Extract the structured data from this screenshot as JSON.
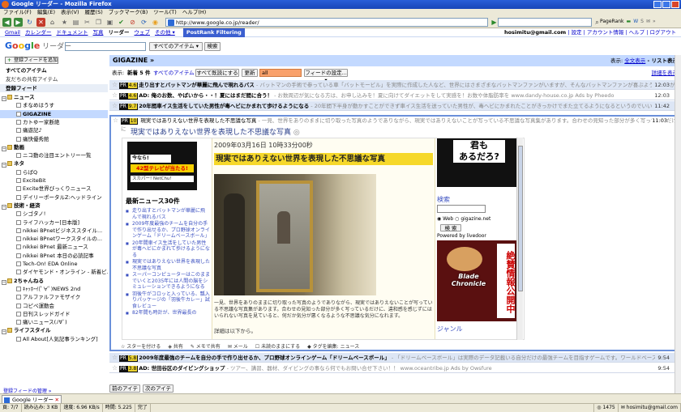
{
  "window": {
    "title": "Google リーダー - Mozilla Firefox"
  },
  "menu": [
    "ファイル(F)",
    "編集(E)",
    "表示(V)",
    "履歴(S)",
    "ブックマーク(B)",
    "ツール(T)",
    "ヘルプ(H)"
  ],
  "nav": {
    "url": "http://www.google.co.jp/reader/",
    "pagerank": "PageRank"
  },
  "gbar": {
    "links": [
      "Gmail",
      "カレンダー",
      "ドキュメント",
      "写真"
    ],
    "current": "リーダー",
    "links2": [
      "ウェブ",
      "その他 ▾"
    ],
    "prf": "PostRank Filtering",
    "email": "hosimitu@gmail.com",
    "right_links": "設定 | アカウント情報 | ヘルプ | ログアウト"
  },
  "header": {
    "logo_google": [
      "G",
      "o",
      "o",
      "g",
      "l",
      "e"
    ],
    "logo_reader": " リーダー",
    "all_items_btn": "すべてのアイテム ▾",
    "search_btn": "検索"
  },
  "sidebar": {
    "add_feed": "登録フィードを追加",
    "top": [
      {
        "label": "すべてのアイテム",
        "bold": true
      },
      {
        "label": "友だちの共有アイテム",
        "bold": false
      }
    ],
    "section": "登録フィード",
    "items": [
      {
        "label": "ニュース",
        "type": "folder",
        "indent": 0,
        "toggle": "−"
      },
      {
        "label": "まなめはうす",
        "type": "feed",
        "indent": 1
      },
      {
        "label": "GIGAZINE",
        "type": "feed",
        "indent": 1,
        "selected": true
      },
      {
        "label": "カトゆー家断絶",
        "type": "feed",
        "indent": 1
      },
      {
        "label": "痛遊記♪",
        "type": "feed",
        "indent": 1
      },
      {
        "label": "痛快優秀館",
        "type": "feed",
        "indent": 1
      },
      {
        "label": "動画",
        "type": "folder",
        "indent": 0,
        "toggle": "−"
      },
      {
        "label": "ニコ動の注目エントリー一覧",
        "type": "feed",
        "indent": 1
      },
      {
        "label": "ネタ",
        "type": "folder",
        "indent": 0,
        "toggle": "−"
      },
      {
        "label": "らばQ",
        "type": "feed",
        "indent": 1
      },
      {
        "label": "ExciteBit",
        "type": "feed",
        "indent": 1
      },
      {
        "label": "Excite世界びっくりニュース",
        "type": "feed",
        "indent": 1
      },
      {
        "label": "デイリーポータルZ:ヘッドライン",
        "type": "feed",
        "indent": 1
      },
      {
        "label": "技術・経済",
        "type": "folder",
        "indent": 0,
        "toggle": "−"
      },
      {
        "label": "シゴタノ!",
        "type": "feed",
        "indent": 1
      },
      {
        "label": "ライフハッカー[日本版]",
        "type": "feed",
        "indent": 1
      },
      {
        "label": "nikkei BPnetビジネススタイル...",
        "type": "feed",
        "indent": 1
      },
      {
        "label": "nikkei BPnetワークスタイルの...",
        "type": "feed",
        "indent": 1
      },
      {
        "label": "nikkei BPnet 最新ニュース",
        "type": "feed",
        "indent": 1
      },
      {
        "label": "nikkei BPnet 本日の必読記事",
        "type": "feed",
        "indent": 1
      },
      {
        "label": "Tech-On! EDA Online",
        "type": "feed",
        "indent": 1
      },
      {
        "label": "ダイヤモンド・オンライン - 新着ビ...",
        "type": "feed",
        "indent": 1
      },
      {
        "label": "2ちゃんねる",
        "type": "folder",
        "indent": 0,
        "toggle": "−"
      },
      {
        "label": "ｷｬｯﾎｰｲ(ﾟ∀ﾟ)NEWS 2nd",
        "type": "feed",
        "indent": 1
      },
      {
        "label": "アルファルファモザイク",
        "type": "feed",
        "indent": 1
      },
      {
        "label": "コピペ運動会",
        "type": "feed",
        "indent": 1
      },
      {
        "label": "日刊スレッドガイド",
        "type": "feed",
        "indent": 1
      },
      {
        "label": "痛いニュース(ﾉ∀`)",
        "type": "feed",
        "indent": 1
      },
      {
        "label": "ライフスタイル",
        "type": "folder",
        "indent": 0,
        "toggle": "−"
      },
      {
        "label": "All About[人気記事ランキング]",
        "type": "feed",
        "indent": 1
      }
    ],
    "footer": "登録フィードの管理 »"
  },
  "main": {
    "feed_title": "GIGAZINE »",
    "view_label": "表示: ",
    "view_full": "全文表示",
    "view_list": " - リスト表示",
    "toolbar": {
      "show_label": "表示:",
      "new_count": "新着 5 件",
      "all_items": "すべてのアイテム",
      "mark_all": "すべて既読にする",
      "refresh": "更新",
      "filter_value": "all",
      "feed_settings": "フィードの設定... ▾",
      "detail": "詳細を表示"
    },
    "entries": [
      {
        "score": "4.6",
        "title": "走り出すとバットマンが華麗に飛んで現れるバス",
        "snippet": " - バットマンの手術で参っている車「バットモービル」を実際に作成した人など、世界にはさまざまなバットマンファンがいますが、そんなバットマンファンが喜ぶようなバスがイ",
        "time": "12:03",
        "bold": true,
        "shade": true
      },
      {
        "score": "4.6",
        "title": "AD: 俺のお数、やばいから・・！夏にはまだ間に合う！",
        "snippet": " - お数周辺が気になる方は、お申し込みを！夏に向けてダイエットをして実感を！お数や体脂肪率を www.dandy-house.co.jp Ads by Pheedo",
        "time": "12:03",
        "bold": true,
        "shade": false
      },
      {
        "score": "9.7",
        "title": "20年間車イス生活をしていた男性が毒ヘビにかまれて歩けるようになる",
        "snippet": " - 20年間下半身が動かすことができず車イス生活を送っていた男性が、毒ヘビにかまれたことがきっかけでまた立てるようになるというのでいいです。",
        "time": "11:42",
        "bold": true,
        "shade": true
      }
    ],
    "open": {
      "score": "10",
      "title": "現実ではありえない世界を表現した不思議な写真",
      "snippet": " - 一見、世界をありのままに切り取った写真のようでありながら、現実ではありえないことが写っている不思議な写真集があります。合わせの見知った部分が多く写っているだけに",
      "time": "11:03",
      "heading": "現実ではありえない世界を表現した不思議な写真",
      "ad_top": "今なら!",
      "ad_main": "42型テレビが当たる!",
      "ad_sub": "スカパー! NetChu!",
      "news_header": "最新ニュース30件",
      "news": [
        "走り出すとバットマンが華麗に飛んで現れるバス",
        "2009年度最強のチームを自分の手で作り出せるか、プロ野球オンラインゲーム「ドリームベースボール」",
        "20年間車イス生活をしていた男性が毒ヘビにかまれて歩けるようになる",
        "現実ではありえない世界を表現した不思議な写真",
        "スーパーコンピューターはこのままでいくと2035年には人間の脳をシミュレーションできるようになる",
        "羽後牛がコロッと入っている、瓢入りパッケージの「羽後牛カレー」試食レビュー",
        "82年間も時計が、世界最長の"
      ],
      "article_date": "2009年03月16日 10時33分00秒",
      "article_title": "現実ではありえない世界を表現した不思議な写真",
      "article_body": "一見、世界をありのままに切り取った写真のようでありながら、現実ではありえないことが写っている不思議な写真集があります。合わせの見知った部分が多く写っているだけに、違和感を感じずにはいられない写真を見ていると、何だか気分が悪くなるような不思議な気分になれます。",
      "article_more": "詳細は以下から。",
      "right_top": [
        "君も",
        "あるだろ?"
      ],
      "search_header": "検索",
      "radio_web": "Web",
      "radio_site": "gigazine.net",
      "search_btn": "検 索",
      "byline": "Powered by livedoor",
      "manga_tate": "絶賛情報公開中",
      "manga_title": "Blade Chronicle",
      "genre": "ジャンル"
    },
    "actions": [
      "スターを付ける",
      "共有",
      "メモで共有",
      "メール",
      "未読のままにする",
      "タグを編集:",
      "ニュース"
    ],
    "entries2": [
      {
        "score": "5.8",
        "title": "2009年度最強のチームを自分の手で作り出せるか、プロ野球オンラインゲーム「ドリームベースボール」",
        "snippet": " - 「ドリームベースボール」は実際のデータ記載いる自分だけの最強チームを目指すゲームです。ワールドベース",
        "time": "9:54",
        "bold": true,
        "shade": true
      },
      {
        "score": "3.8",
        "title": "AD: 世田谷区のダイビングショップ",
        "snippet": " - ツアー、講習、器材、ダイビングの事なら何でもお問い合せ下さい！！ www.oceantribe.jp Ads by Owsfure",
        "time": "9:54",
        "bold": true,
        "shade": false
      }
    ],
    "prev_btn": "前のアイテム",
    "next_btn": "次のアイテム"
  },
  "tab": {
    "label": "Google リーダー"
  },
  "status": {
    "pages": "7/7",
    "load": "読み込み: 3 KB",
    "speed": "速度: 6.96 KB/s",
    "time": "時間: 5.225",
    "done": "完了",
    "count": "1475",
    "email": "hosimitu@gmail.com"
  }
}
